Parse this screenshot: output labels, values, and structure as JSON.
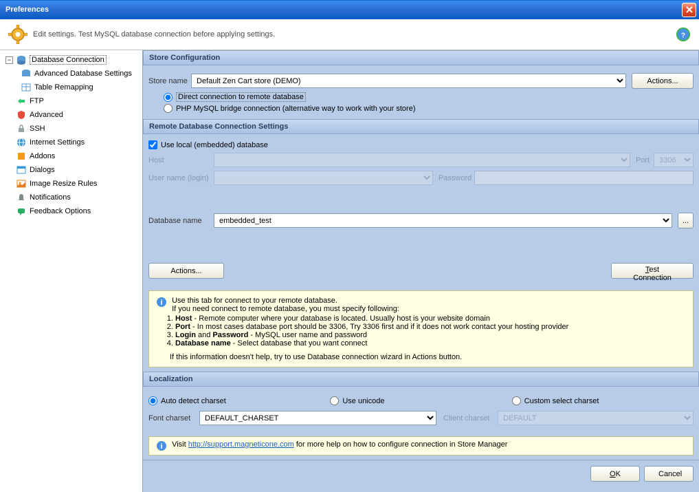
{
  "title": "Preferences",
  "header_text": "Edit settings. Test MySQL database connection before applying settings.",
  "sidebar": {
    "items": [
      {
        "label": "Database Connection",
        "icon": "#4a90e2"
      },
      {
        "label": "Advanced Database Settings",
        "icon": "#4a90e2"
      },
      {
        "label": "Table Remapping",
        "icon": "#4a90e2"
      },
      {
        "label": "FTP",
        "icon": "#2ecc71"
      },
      {
        "label": "Advanced",
        "icon": "#e74c3c"
      },
      {
        "label": "SSH",
        "icon": "#95a5a6"
      },
      {
        "label": "Internet Settings",
        "icon": "#3498db"
      },
      {
        "label": "Addons",
        "icon": "#f39c12"
      },
      {
        "label": "Dialogs",
        "icon": "#3498db"
      },
      {
        "label": "Image Resize Rules",
        "icon": "#e67e22"
      },
      {
        "label": "Notifications",
        "icon": "#7f8c8d"
      },
      {
        "label": "Feedback Options",
        "icon": "#27ae60"
      }
    ]
  },
  "store_config": {
    "heading": "Store Configuration",
    "store_name_label": "Store name",
    "store_name_value": "Default Zen Cart store (DEMO)",
    "actions_label": "Actions...",
    "radio1": "Direct connection to remote database",
    "radio2": "PHP MySQL bridge connection (alternative way to work with your store)"
  },
  "remote_db": {
    "heading": "Remote Database Connection Settings",
    "use_local_label": "Use local (embedded) database",
    "host_label": "Host",
    "port_label": "Port",
    "port_value": "3306",
    "user_label": "User name (login)",
    "pass_label": "Password",
    "dbname_label": "Database name",
    "dbname_value": "embedded_test",
    "actions_label": "Actions...",
    "test_label": "Test Connection"
  },
  "info": {
    "line1": "Use this tab for connect to your remote database.",
    "line2": "If you need connect to remote database, you must specify following:",
    "b1_bold": "Host",
    "b1_rest": " - Remote computer where your database is located. Usually host is your website domain",
    "b2_bold": "Port",
    "b2_rest": " - In most cases database port should be 3306, Try 3306 first and if it does not work contact your hosting provider",
    "b3_bold1": "Login",
    "b3_mid": " and ",
    "b3_bold2": "Password",
    "b3_rest": " - MySQL user name and password",
    "b4_bold": "Database name",
    "b4_rest": " - Select database that you want connect",
    "footer": "If this information doesn't help, try to use Database connection wizard in Actions button."
  },
  "localization": {
    "heading": "Localization",
    "r1": "Auto detect charset",
    "r2": "Use unicode",
    "r3": "Custom select charset",
    "font_label": "Font charset",
    "font_value": "DEFAULT_CHARSET",
    "client_label": "Client charset",
    "client_value": "DEFAULT"
  },
  "help_box": {
    "pre": "Visit ",
    "link": "http://support.magneticone.com",
    "post": " for more help on how to configure connection in Store Manager"
  },
  "buttons": {
    "ok": "OK",
    "cancel": "Cancel"
  }
}
